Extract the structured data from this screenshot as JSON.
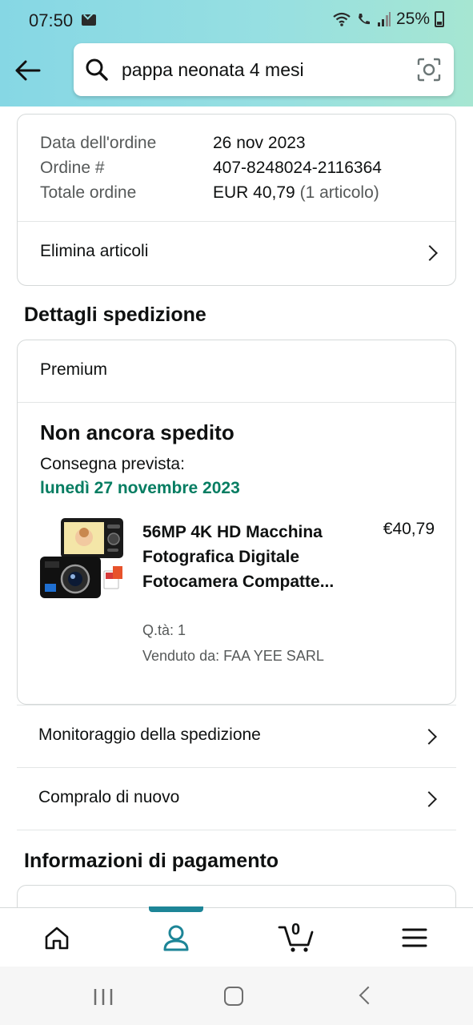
{
  "status_bar": {
    "time": "07:50",
    "battery": "25%"
  },
  "search": {
    "query": "pappa neonata 4 mesi"
  },
  "order_summary": {
    "date_label": "Data dell'ordine",
    "date_value": "26 nov 2023",
    "number_label": "Ordine #",
    "number_value": "407-8248024-2116364",
    "total_label": "Totale ordine",
    "total_value": "EUR 40,79",
    "total_count": "(1 articolo)",
    "delete_items": "Elimina articoli"
  },
  "shipping": {
    "heading": "Dettagli spedizione",
    "tier": "Premium",
    "status": "Non ancora spedito",
    "eta_label": "Consegna prevista:",
    "eta_date": "lunedì 27 novembre 2023",
    "product": {
      "title": "56MP 4K HD Macchina Fotografica Digitale Fotocamera Compatte...",
      "price": "€40,79",
      "quantity": "Q.tà: 1",
      "seller": "Venduto da: FAA YEE SARL"
    },
    "track": "Monitoraggio della spedizione",
    "buy_again": "Compralo di nuovo"
  },
  "payment": {
    "heading": "Informazioni di pagamento"
  },
  "bottom_nav": {
    "cart_count": "0",
    "active": "account"
  },
  "colors": {
    "accent": "#1d8597",
    "delivery_green": "#067d62",
    "header_gradient_start": "#86d7e4",
    "header_gradient_end": "#a6e6d2"
  }
}
